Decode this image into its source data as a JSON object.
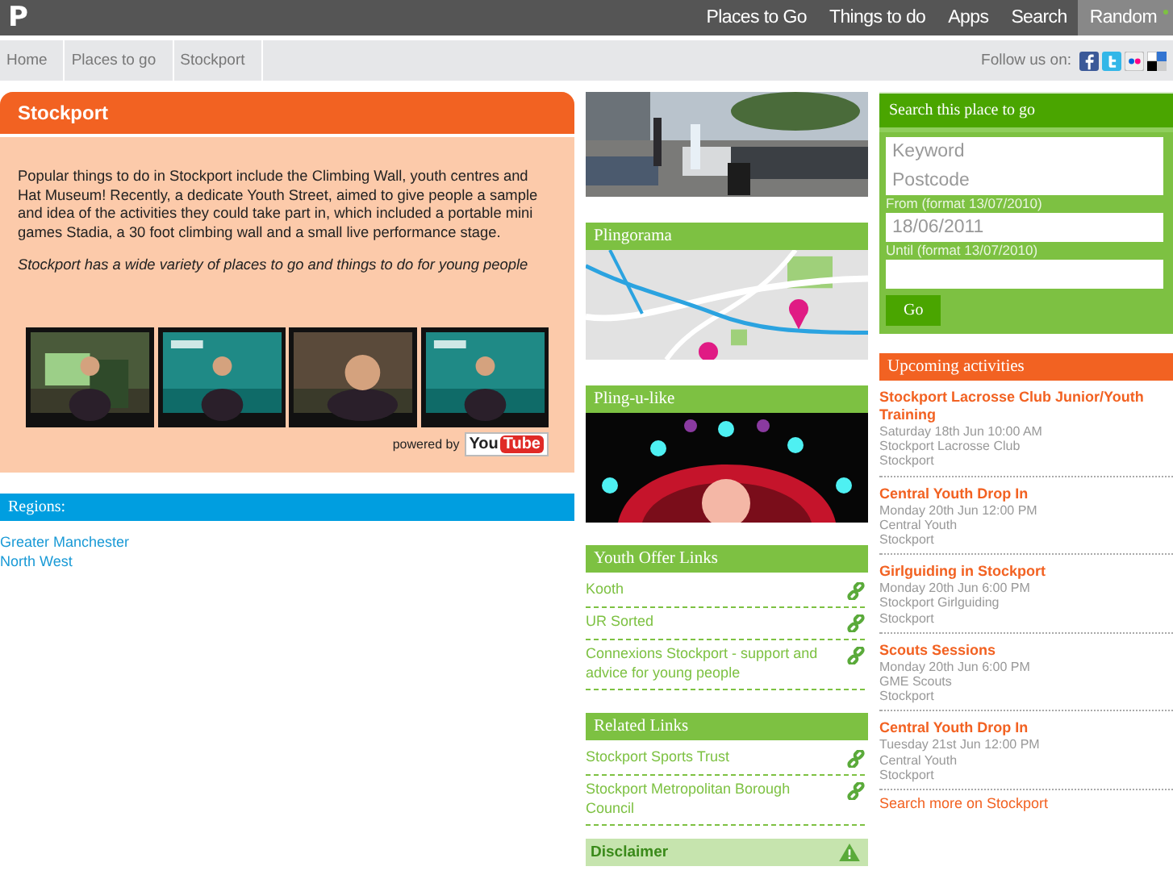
{
  "top_nav": {
    "logo": "P",
    "items": [
      {
        "label": "Places to Go",
        "selected": false
      },
      {
        "label": "Things to do",
        "selected": false
      },
      {
        "label": "Apps",
        "selected": false
      },
      {
        "label": "Search",
        "selected": false
      },
      {
        "label": "Random",
        "selected": true
      }
    ]
  },
  "breadcrumb": [
    "Home",
    "Places to go",
    "Stockport"
  ],
  "follow_label": "Follow us on:",
  "place": {
    "title": "Stockport",
    "description": "Popular things to do in Stockport include the Climbing Wall, youth centres and Hat Museum! Recently, a dedicate Youth Street, aimed to give people a sample and idea of the activities they could take part in, which included a portable mini games Stadia, a 30 foot climbing wall and a small live performance stage.",
    "tagline": "Stockport has a wide variety of places to go and things to do for young people",
    "powered_by": "powered by",
    "youtube_you": "You",
    "youtube_tube": "Tube"
  },
  "regions": {
    "title": "Regions:",
    "items": [
      "Greater Manchester",
      "North West"
    ]
  },
  "plingorama": {
    "title": "Plingorama"
  },
  "pling_u_like": {
    "title": "Pling-u-like"
  },
  "youth_offer_links": {
    "title": "Youth Offer Links",
    "items": [
      "Kooth",
      "UR Sorted",
      "Connexions Stockport - support and advice for young people"
    ]
  },
  "related_links": {
    "title": "Related Links",
    "items": [
      "Stockport Sports Trust",
      "Stockport Metropolitan Borough Council"
    ]
  },
  "disclaimer": "Disclaimer",
  "search": {
    "title": "Search this place to go",
    "keyword": {
      "placeholder": "Keyword"
    },
    "postcode": {
      "placeholder": "Postcode"
    },
    "from_label": "From (format 13/07/2010)",
    "from": {
      "value": "18/06/2011"
    },
    "until_label": "Until (format 13/07/2010)",
    "button": "Go"
  },
  "activities": {
    "title": "Upcoming activities",
    "items": [
      {
        "name": "Stockport Lacrosse Club Junior/Youth Training",
        "when": "Saturday 18th Jun 10:00 AM",
        "venue": "Stockport Lacrosse Club",
        "town": "Stockport"
      },
      {
        "name": "Central Youth Drop In",
        "when": "Monday 20th Jun 12:00 PM",
        "venue": "Central Youth",
        "town": "Stockport"
      },
      {
        "name": "Girlguiding in Stockport",
        "when": "Monday 20th Jun 6:00 PM",
        "venue": "Stockport Girlguiding",
        "town": "Stockport"
      },
      {
        "name": "Scouts Sessions",
        "when": "Monday 20th Jun 6:00 PM",
        "venue": "GME Scouts",
        "town": "Stockport"
      },
      {
        "name": "Central Youth Drop In",
        "when": "Tuesday 21st Jun 12:00 PM",
        "venue": "Central Youth",
        "town": "Stockport"
      }
    ],
    "more": "Search more on Stockport"
  }
}
